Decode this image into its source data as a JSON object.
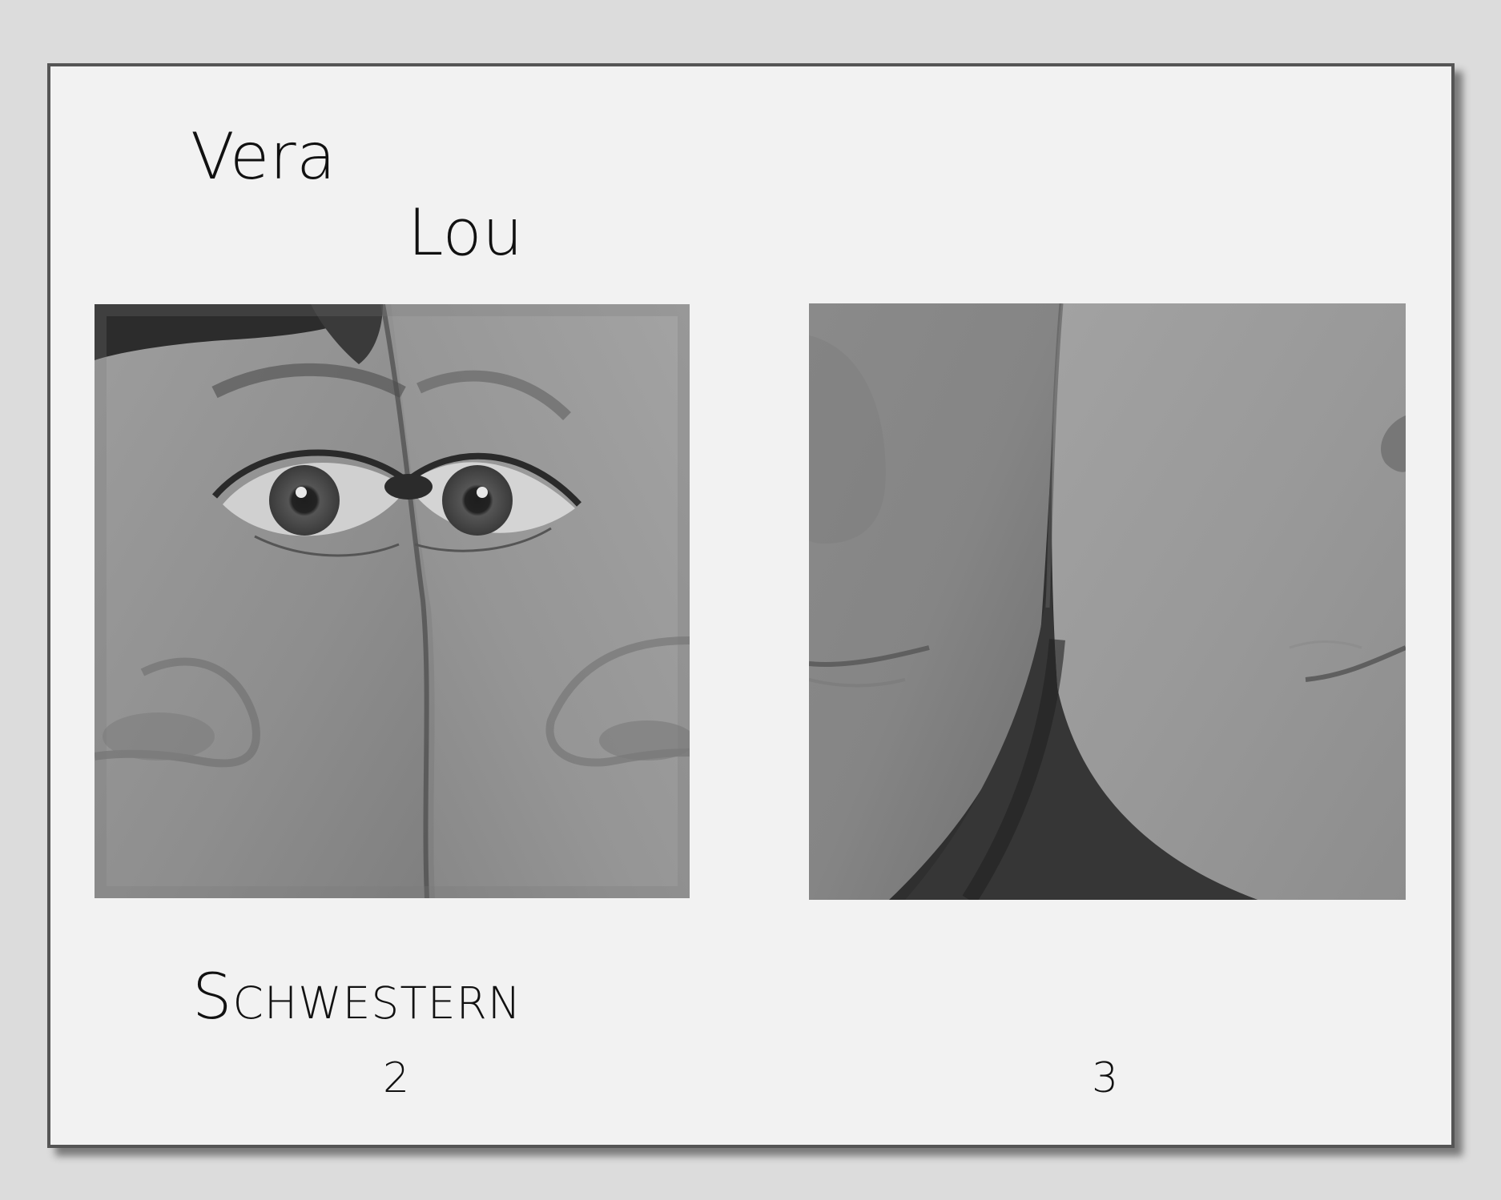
{
  "spread": {
    "names": {
      "first": "Vera",
      "second": "Lou"
    },
    "title": "Schwestern",
    "page_numbers": {
      "left": "2",
      "right": "3"
    },
    "photos": {
      "left": {
        "icon": "sisters-eyes-photo"
      },
      "right": {
        "icon": "sisters-cheeks-photo"
      }
    },
    "colors": {
      "page": "#f2f2f2",
      "border": "#555555",
      "background": "#dcdcdc",
      "text": "#111111"
    }
  }
}
